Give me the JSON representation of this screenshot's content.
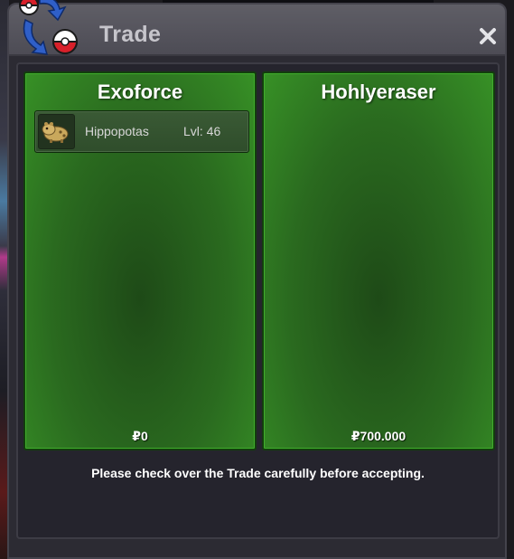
{
  "window": {
    "title": "Trade",
    "icon": "trade-exchange-icon",
    "close_icon": "close-icon"
  },
  "players": [
    {
      "name": "Exoforce",
      "money": "₽0",
      "pokemon": [
        {
          "name": "Hippopotas",
          "level": "Lvl: 46",
          "icon": "hippopotas-sprite-icon"
        }
      ]
    },
    {
      "name": "Hohlyeraser",
      "money": "₽700.000",
      "pokemon": []
    }
  ],
  "footer": {
    "message": "Please check over the Trade carefully before accepting."
  },
  "colors": {
    "panel_green": "#2a6a1f",
    "title_bar": "#55545c",
    "background": "#25242d"
  }
}
